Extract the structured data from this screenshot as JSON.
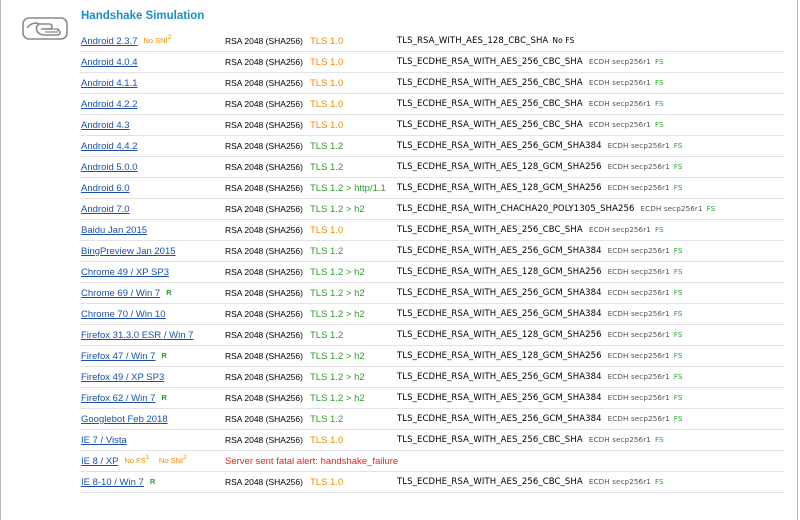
{
  "section": {
    "title": "Handshake Simulation",
    "icon": "handshake-icon"
  },
  "colors": {
    "title": "#1a8fc6",
    "link": "#1c50a8",
    "warn": "#f08a00",
    "good": "#2f9a2f",
    "error": "#e0251f"
  },
  "rows": [
    {
      "client": "Android 2.3.7",
      "flags": [
        {
          "text": "No SNI",
          "sup": "2",
          "type": "warn"
        }
      ],
      "cert": "RSA 2048 (SHA256)",
      "protocol": "TLS 1.0",
      "proto_status": "old",
      "cipher": "TLS_RSA_WITH_AES_128_CBC_SHA",
      "kx": "",
      "fs": "No FS",
      "fs_status": "none"
    },
    {
      "client": "Android 4.0.4",
      "flags": [],
      "cert": "RSA 2048 (SHA256)",
      "protocol": "TLS 1.0",
      "proto_status": "old",
      "cipher": "TLS_ECDHE_RSA_WITH_AES_256_CBC_SHA",
      "kx": "ECDH secp256r1",
      "fs": "FS",
      "fs_status": "good"
    },
    {
      "client": "Android 4.1.1",
      "flags": [],
      "cert": "RSA 2048 (SHA256)",
      "protocol": "TLS 1.0",
      "proto_status": "old",
      "cipher": "TLS_ECDHE_RSA_WITH_AES_256_CBC_SHA",
      "kx": "ECDH secp256r1",
      "fs": "FS",
      "fs_status": "good"
    },
    {
      "client": "Android 4.2.2",
      "flags": [],
      "cert": "RSA 2048 (SHA256)",
      "protocol": "TLS 1.0",
      "proto_status": "old",
      "cipher": "TLS_ECDHE_RSA_WITH_AES_256_CBC_SHA",
      "kx": "ECDH secp256r1",
      "fs": "FS",
      "fs_status": "good"
    },
    {
      "client": "Android 4.3",
      "flags": [],
      "cert": "RSA 2048 (SHA256)",
      "protocol": "TLS 1.0",
      "proto_status": "old",
      "cipher": "TLS_ECDHE_RSA_WITH_AES_256_CBC_SHA",
      "kx": "ECDH secp256r1",
      "fs": "FS",
      "fs_status": "good"
    },
    {
      "client": "Android 4.4.2",
      "flags": [],
      "cert": "RSA 2048 (SHA256)",
      "protocol": "TLS 1.2",
      "proto_status": "good",
      "cipher": "TLS_ECDHE_RSA_WITH_AES_256_GCM_SHA384",
      "kx": "ECDH secp256r1",
      "fs": "FS",
      "fs_status": "good"
    },
    {
      "client": "Android 5.0.0",
      "flags": [],
      "cert": "RSA 2048 (SHA256)",
      "protocol": "TLS 1.2",
      "proto_status": "good",
      "cipher": "TLS_ECDHE_RSA_WITH_AES_128_GCM_SHA256",
      "kx": "ECDH secp256r1",
      "fs": "FS",
      "fs_status": "good"
    },
    {
      "client": "Android 6.0",
      "flags": [],
      "cert": "RSA 2048 (SHA256)",
      "protocol": "TLS 1.2 > http/1.1",
      "proto_status": "good",
      "cipher": "TLS_ECDHE_RSA_WITH_AES_128_GCM_SHA256",
      "kx": "ECDH secp256r1",
      "fs": "FS",
      "fs_status": "good"
    },
    {
      "client": "Android 7.0",
      "flags": [],
      "cert": "RSA 2048 (SHA256)",
      "protocol": "TLS 1.2 > h2",
      "proto_status": "good",
      "cipher": "TLS_ECDHE_RSA_WITH_CHACHA20_POLY1305_SHA256",
      "kx": "ECDH secp256r1",
      "fs": "FS",
      "fs_status": "good"
    },
    {
      "client": "Baidu Jan 2015",
      "flags": [],
      "cert": "RSA 2048 (SHA256)",
      "protocol": "TLS 1.0",
      "proto_status": "old",
      "cipher": "TLS_ECDHE_RSA_WITH_AES_256_CBC_SHA",
      "kx": "ECDH secp256r1",
      "fs": "FS",
      "fs_status": "good"
    },
    {
      "client": "BingPreview Jan 2015",
      "flags": [],
      "cert": "RSA 2048 (SHA256)",
      "protocol": "TLS 1.2",
      "proto_status": "good",
      "cipher": "TLS_ECDHE_RSA_WITH_AES_256_GCM_SHA384",
      "kx": "ECDH secp256r1",
      "fs": "FS",
      "fs_status": "good"
    },
    {
      "client": "Chrome 49 / XP SP3",
      "flags": [],
      "cert": "RSA 2048 (SHA256)",
      "protocol": "TLS 1.2 > h2",
      "proto_status": "good",
      "cipher": "TLS_ECDHE_RSA_WITH_AES_128_GCM_SHA256",
      "kx": "ECDH secp256r1",
      "fs": "FS",
      "fs_status": "good"
    },
    {
      "client": "Chrome 69 / Win 7",
      "flags": [
        {
          "text": "R",
          "sup": "",
          "type": "ok"
        }
      ],
      "cert": "RSA 2048 (SHA256)",
      "protocol": "TLS 1.2 > h2",
      "proto_status": "good",
      "cipher": "TLS_ECDHE_RSA_WITH_AES_256_GCM_SHA384",
      "kx": "ECDH secp256r1",
      "fs": "FS",
      "fs_status": "good"
    },
    {
      "client": "Chrome 70 / Win 10",
      "flags": [],
      "cert": "RSA 2048 (SHA256)",
      "protocol": "TLS 1.2 > h2",
      "proto_status": "good",
      "cipher": "TLS_ECDHE_RSA_WITH_AES_256_GCM_SHA384",
      "kx": "ECDH secp256r1",
      "fs": "FS",
      "fs_status": "good"
    },
    {
      "client": "Firefox 31.3.0 ESR / Win 7",
      "flags": [],
      "cert": "RSA 2048 (SHA256)",
      "protocol": "TLS 1.2",
      "proto_status": "good",
      "cipher": "TLS_ECDHE_RSA_WITH_AES_128_GCM_SHA256",
      "kx": "ECDH secp256r1",
      "fs": "FS",
      "fs_status": "good"
    },
    {
      "client": "Firefox 47 / Win 7",
      "flags": [
        {
          "text": "R",
          "sup": "",
          "type": "ok"
        }
      ],
      "cert": "RSA 2048 (SHA256)",
      "protocol": "TLS 1.2 > h2",
      "proto_status": "good",
      "cipher": "TLS_ECDHE_RSA_WITH_AES_128_GCM_SHA256",
      "kx": "ECDH secp256r1",
      "fs": "FS",
      "fs_status": "good"
    },
    {
      "client": "Firefox 49 / XP SP3",
      "flags": [],
      "cert": "RSA 2048 (SHA256)",
      "protocol": "TLS 1.2 > h2",
      "proto_status": "good",
      "cipher": "TLS_ECDHE_RSA_WITH_AES_256_GCM_SHA384",
      "kx": "ECDH secp256r1",
      "fs": "FS",
      "fs_status": "good"
    },
    {
      "client": "Firefox 62 / Win 7",
      "flags": [
        {
          "text": "R",
          "sup": "",
          "type": "ok"
        }
      ],
      "cert": "RSA 2048 (SHA256)",
      "protocol": "TLS 1.2 > h2",
      "proto_status": "good",
      "cipher": "TLS_ECDHE_RSA_WITH_AES_256_GCM_SHA384",
      "kx": "ECDH secp256r1",
      "fs": "FS",
      "fs_status": "good"
    },
    {
      "client": "Googlebot Feb 2018",
      "flags": [],
      "cert": "RSA 2048 (SHA256)",
      "protocol": "TLS 1.2",
      "proto_status": "good",
      "cipher": "TLS_ECDHE_RSA_WITH_AES_256_GCM_SHA384",
      "kx": "ECDH secp256r1",
      "fs": "FS",
      "fs_status": "good"
    },
    {
      "client": "IE 7 / Vista",
      "flags": [],
      "cert": "RSA 2048 (SHA256)",
      "protocol": "TLS 1.0",
      "proto_status": "old",
      "cipher": "TLS_ECDHE_RSA_WITH_AES_256_CBC_SHA",
      "kx": "ECDH secp256r1",
      "fs": "FS",
      "fs_status": "good"
    },
    {
      "client": "IE 8 / XP",
      "flags": [
        {
          "text": "No FS",
          "sup": "1",
          "type": "warn"
        },
        {
          "text": "No SNI",
          "sup": "2",
          "type": "warn"
        }
      ],
      "error": "Server sent fatal alert: handshake_failure"
    },
    {
      "client": "IE 8-10 / Win 7",
      "flags": [
        {
          "text": "R",
          "sup": "",
          "type": "ok"
        }
      ],
      "cert": "RSA 2048 (SHA256)",
      "protocol": "TLS 1.0",
      "proto_status": "old",
      "cipher": "TLS_ECDHE_RSA_WITH_AES_256_CBC_SHA",
      "kx": "ECDH secp256r1",
      "fs": "FS",
      "fs_status": "good"
    }
  ]
}
